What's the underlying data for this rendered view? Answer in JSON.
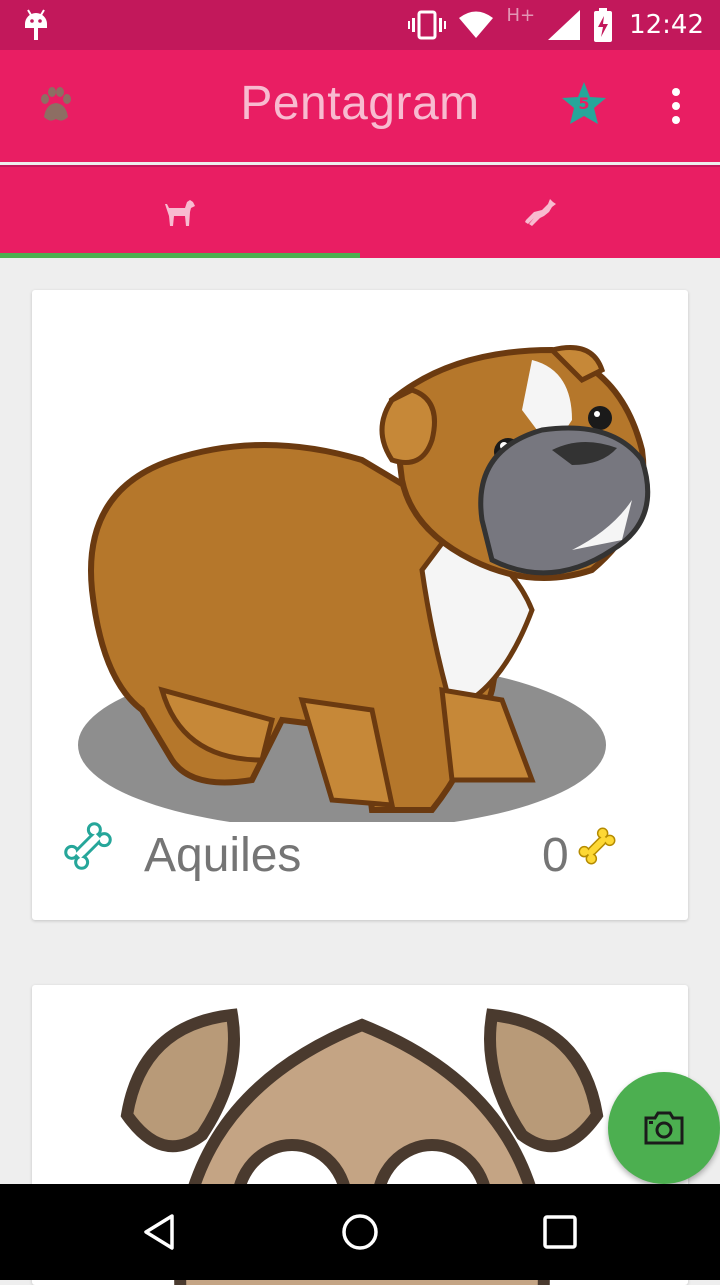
{
  "status_bar": {
    "time": "12:42",
    "network_type": "H+",
    "icons": [
      "android-debug-icon",
      "vibrate-icon",
      "wifi-icon",
      "cell-signal-icon",
      "battery-charging-icon"
    ]
  },
  "app_bar": {
    "title": "Pentagram",
    "star_count": "5",
    "icons": [
      "paw-icon",
      "star-icon",
      "overflow-menu-icon"
    ]
  },
  "tabs": [
    {
      "icon": "dog-standing-icon",
      "selected": true
    },
    {
      "icon": "dog-running-icon",
      "selected": false
    }
  ],
  "pets": [
    {
      "name": "Aquiles",
      "likes": "0",
      "image": "bulldog-cartoon"
    },
    {
      "name": "",
      "likes": "",
      "image": "dog-face-cartoon"
    }
  ],
  "fab": {
    "icon": "camera-icon"
  },
  "nav_bar": {
    "icons": [
      "back-icon",
      "home-icon",
      "recents-icon"
    ]
  },
  "colors": {
    "status_bar": "#C2185B",
    "primary": "#E91E63",
    "accent": "#4CAF50",
    "title_text": "#F8BBD0",
    "bone_teal": "#26A69A",
    "bone_yellow": "#FDD835",
    "star": "#26A69A"
  }
}
